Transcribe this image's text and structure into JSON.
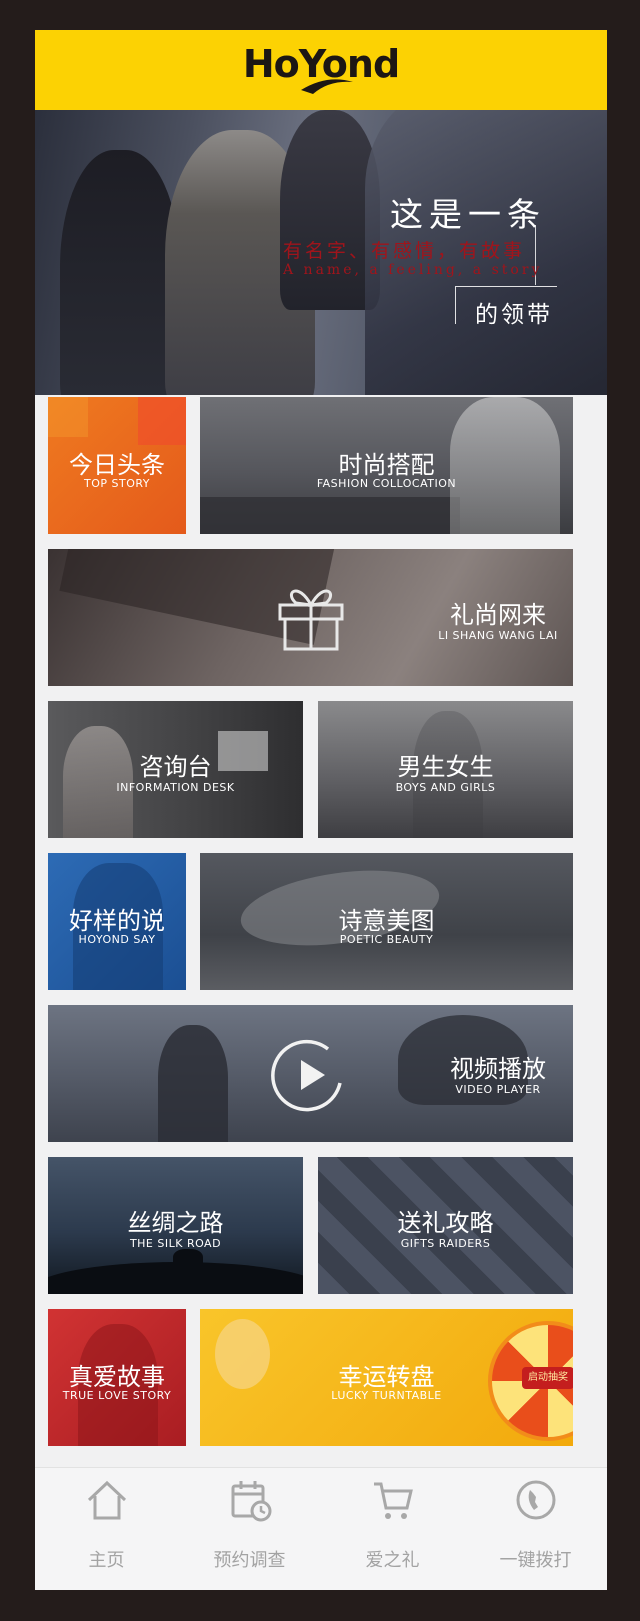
{
  "header": {
    "logo": "HoYond"
  },
  "banner": {
    "title": "这是一条",
    "subtitle_cn": "有名字、有感情，有故事",
    "subtitle_en": "A name, a feeling, a story",
    "tail": "的领带"
  },
  "tiles": [
    {
      "cn": "今日头条",
      "en": "TOP STORY",
      "color": "#ea6b1d"
    },
    {
      "cn": "时尚搭配",
      "en": "FASHION COLLOCATION"
    },
    {
      "cn": "礼尚网来",
      "en": "LI SHANG WANG LAI",
      "icon": "gift-icon"
    },
    {
      "cn": "咨询台",
      "en": "INFORMATION DESK"
    },
    {
      "cn": "男生女生",
      "en": "BOYS AND GIRLS"
    },
    {
      "cn": "好样的说",
      "en": "HOYOND SAY",
      "color": "#1e5aa0"
    },
    {
      "cn": "诗意美图",
      "en": "POETIC BEAUTY"
    },
    {
      "cn": "视频播放",
      "en": "VIDEO PLAYER",
      "icon": "play-icon"
    },
    {
      "cn": "丝绸之路",
      "en": "THE SILK ROAD"
    },
    {
      "cn": "送礼攻略",
      "en": "GIFTS RAIDERS"
    },
    {
      "cn": "真爱故事",
      "en": "TRUE LOVE STORY",
      "color": "#c0282b"
    },
    {
      "cn": "幸运转盘",
      "en": "LUCKY TURNTABLE",
      "color": "#f5b700",
      "wheel_label": "启动抽奖"
    }
  ],
  "tabbar": [
    {
      "label": "主页",
      "icon": "home-icon"
    },
    {
      "label": "预约调查",
      "icon": "calendar-icon"
    },
    {
      "label": "爱之礼",
      "icon": "cart-icon"
    },
    {
      "label": "一键拨打",
      "icon": "phone-icon"
    }
  ]
}
